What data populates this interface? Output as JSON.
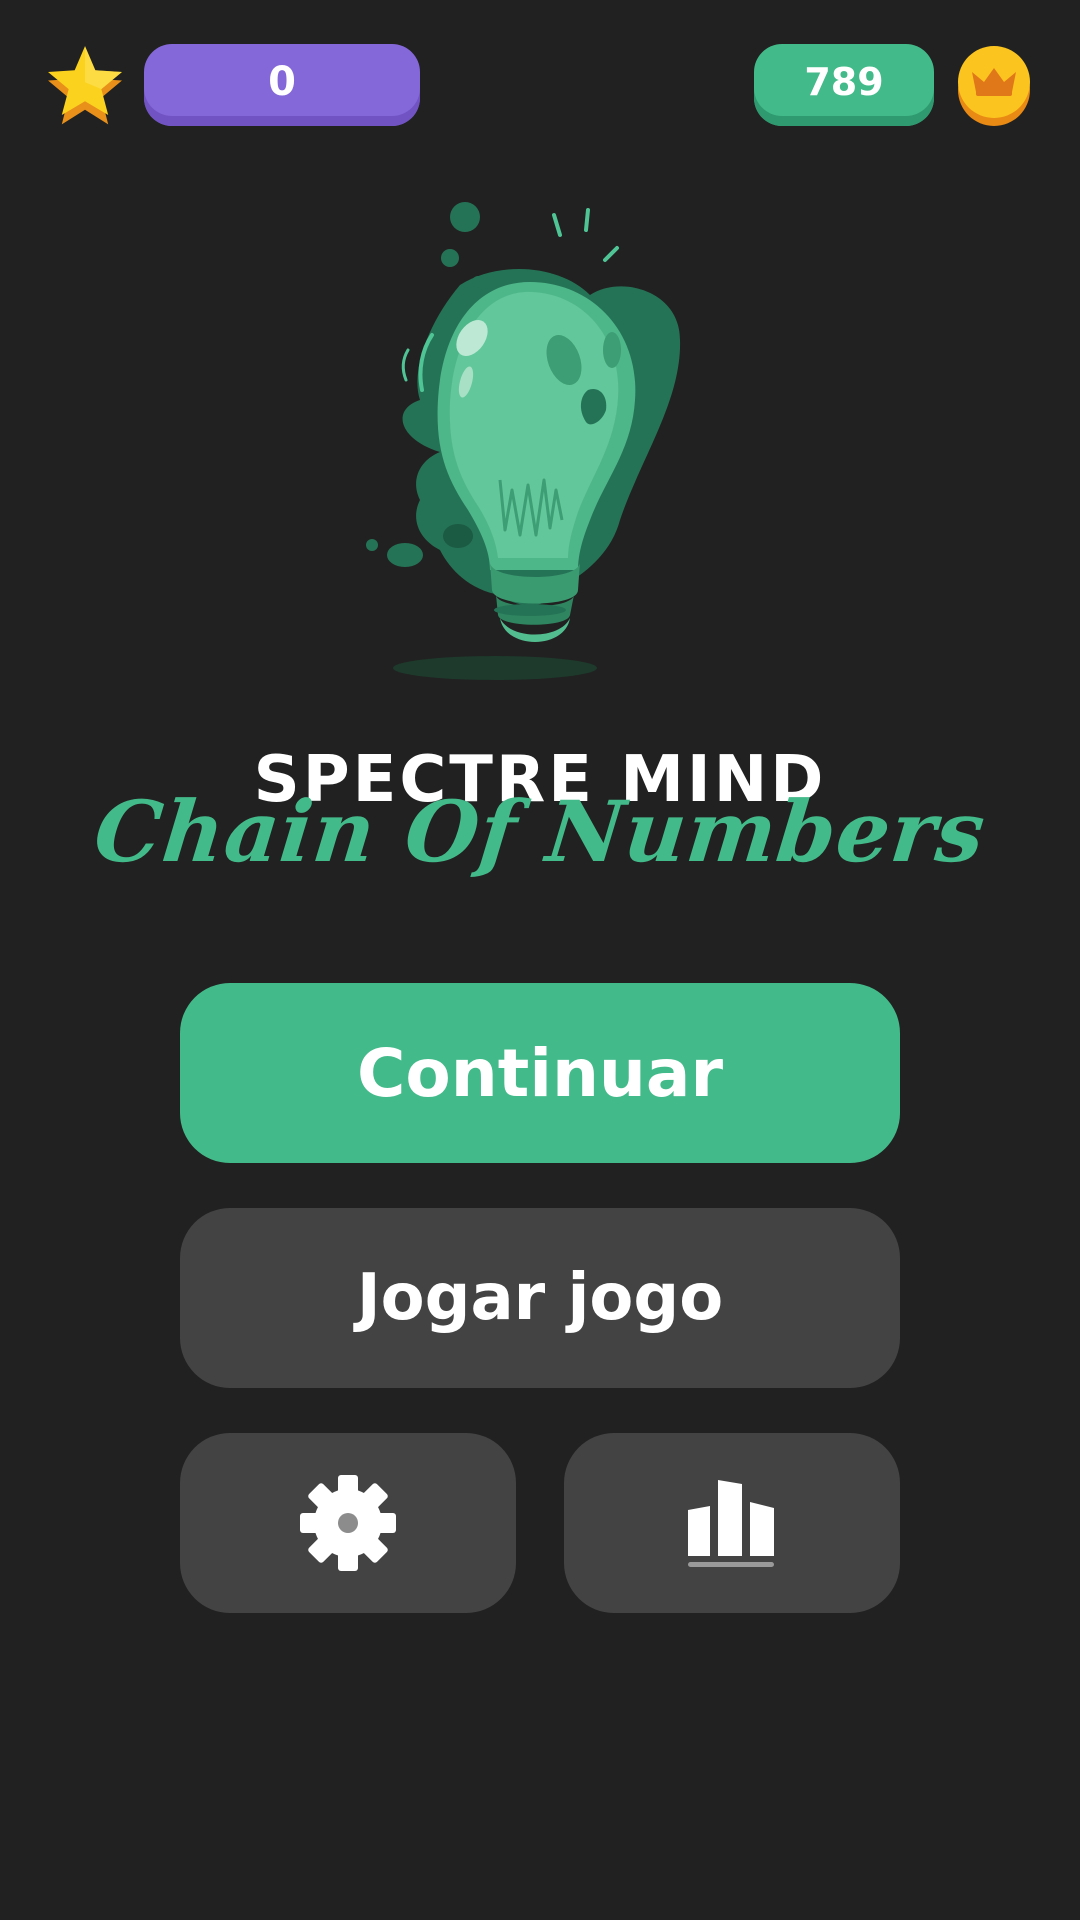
{
  "header": {
    "stars_count": "0",
    "coins_count": "789",
    "star_icon": "star-icon",
    "crown_icon": "crown-coin-icon"
  },
  "title": {
    "main": "SPECTRE MIND",
    "subtitle": "Chain Of Numbers"
  },
  "menu": {
    "continue_label": "Continuar",
    "play_label": "Jogar jogo",
    "settings_icon": "gear-icon",
    "leaderboard_icon": "leaderboard-icon"
  },
  "colors": {
    "background": "#212121",
    "accent_green": "#42ba89",
    "accent_purple": "#8467d8",
    "button_gray": "#434343",
    "gold": "#f7c21b"
  }
}
